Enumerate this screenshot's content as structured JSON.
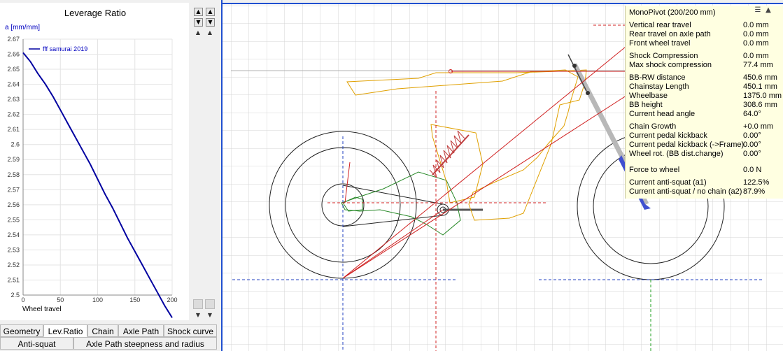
{
  "left_panel": {
    "chart_title": "Leverage Ratio",
    "y_unit_label": "a [mm/mm]",
    "x_label": "Wheel travel",
    "legend": "fff samurai 2019"
  },
  "chart_data": {
    "type": "line",
    "title": "Leverage Ratio",
    "xlabel": "Wheel travel",
    "ylabel": "a [mm/mm]",
    "xlim": [
      0,
      200
    ],
    "ylim": [
      2.5,
      2.67
    ],
    "x_ticks": [
      "0",
      "50",
      "100",
      "150",
      "200"
    ],
    "y_ticks": [
      "2.5",
      "2.51",
      "2.52",
      "2.53",
      "2.54",
      "2.55",
      "2.56",
      "2.57",
      "2.58",
      "2.59",
      "2.6",
      "2.61",
      "2.62",
      "2.63",
      "2.64",
      "2.65",
      "2.66",
      "2.67"
    ],
    "grid": true,
    "legend_position": "top-left",
    "series": [
      {
        "name": "fff samurai 2019",
        "color": "#0000a0",
        "x": [
          0,
          10,
          20,
          30,
          40,
          50,
          60,
          70,
          80,
          90,
          100,
          110,
          120,
          130,
          140,
          150,
          160,
          170,
          180,
          190,
          200
        ],
        "y": [
          2.661,
          2.655,
          2.647,
          2.64,
          2.632,
          2.623,
          2.614,
          2.605,
          2.596,
          2.587,
          2.577,
          2.567,
          2.558,
          2.548,
          2.538,
          2.529,
          2.52,
          2.511,
          2.502,
          2.493,
          2.485
        ]
      }
    ]
  },
  "tabs": {
    "row1": [
      "Geometry",
      "Lev.Ratio",
      "Chain",
      "Axle Path",
      "Shock curve"
    ],
    "row2": [
      "Anti-squat",
      "Axle Path steepness and radius"
    ],
    "active": "Lev.Ratio"
  },
  "info": {
    "title": "MonoPivot (200/200 mm)",
    "rows": [
      {
        "label": "Vertical rear travel",
        "value": "0.0 mm"
      },
      {
        "label": "Rear travel on axle path",
        "value": "0.0 mm"
      },
      {
        "label": "Front wheel travel",
        "value": "0.0 mm"
      },
      {
        "label": "Shock Compression",
        "value": "0.0 mm"
      },
      {
        "label": "Max shock compression",
        "value": "77.4 mm"
      },
      {
        "label": "BB-RW distance",
        "value": "450.6 mm"
      },
      {
        "label": "Chainstay Length",
        "value": "450.1 mm"
      },
      {
        "label": "Wheelbase",
        "value": "1375.0 mm"
      },
      {
        "label": "BB height",
        "value": "308.6 mm"
      },
      {
        "label": "Current head angle",
        "value": "64.0°"
      },
      {
        "label": "Chain Growth",
        "value": "+0.0 mm"
      },
      {
        "label": "Current pedal kickback",
        "value": "0.00°"
      },
      {
        "label": "Current pedal kickback (->Frame)",
        "value": "0.00°"
      },
      {
        "label": "Wheel rot. (BB dist.change)",
        "value": "0.00°"
      },
      {
        "label": "Force to wheel",
        "value": "0.0 N"
      },
      {
        "label": "Current anti-squat (a1)",
        "value": "122.5%"
      },
      {
        "label": "Current anti-squat / no chain (a2)",
        "value": "87.9%"
      }
    ]
  }
}
